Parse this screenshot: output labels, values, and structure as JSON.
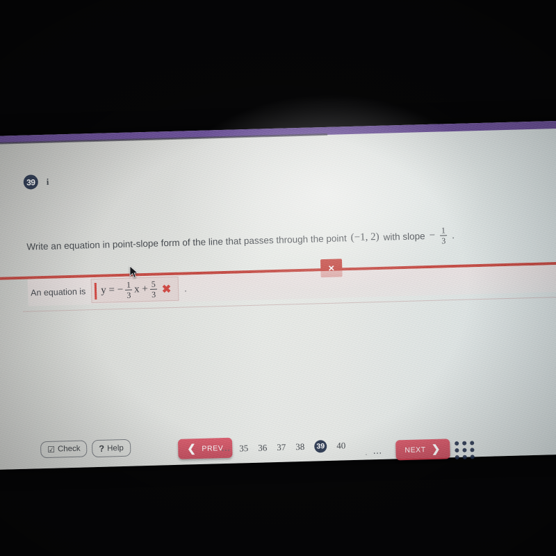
{
  "app": {
    "top_bar_color": "#5a3a8d",
    "screen_background": "#e7e9e4"
  },
  "question": {
    "number_badge": "39",
    "info_icon": "i",
    "prompt_part1": "Write an equation in point-slope form of the line that passes through the point",
    "point": "(−1, 2)",
    "prompt_part2": "with slope",
    "slope_sign": "−",
    "slope_numerator": "1",
    "slope_denominator": "3",
    "prompt_end": "."
  },
  "feedback": {
    "banner_color": "#c3352c",
    "badge_symbol": "×"
  },
  "answer": {
    "label": "An equation is",
    "eq_lhs": "y = −",
    "coef_numerator": "1",
    "coef_denominator": "3",
    "eq_var": "x +",
    "const_numerator": "5",
    "const_denominator": "3",
    "wrong_mark": "✖",
    "trailing_period": ".",
    "wrong_mark_color": "#d0312a"
  },
  "toolbar": {
    "check_label": "Check",
    "check_icon": "☑",
    "help_label": "Help",
    "help_icon": "?",
    "prev_label": "PREV",
    "prev_icon": "❮",
    "next_label": "NEXT",
    "next_icon": "❯",
    "ellipsis_left": "⋯",
    "ellipsis_right": "⋯",
    "tiny_dot": ".",
    "nav_button_color": "#c0394b",
    "pages": [
      {
        "label": "35",
        "current": false
      },
      {
        "label": "36",
        "current": false
      },
      {
        "label": "37",
        "current": false
      },
      {
        "label": "38",
        "current": false
      },
      {
        "label": "39",
        "current": true
      },
      {
        "label": "40",
        "current": false
      }
    ],
    "grid_menu_dots": 9
  }
}
